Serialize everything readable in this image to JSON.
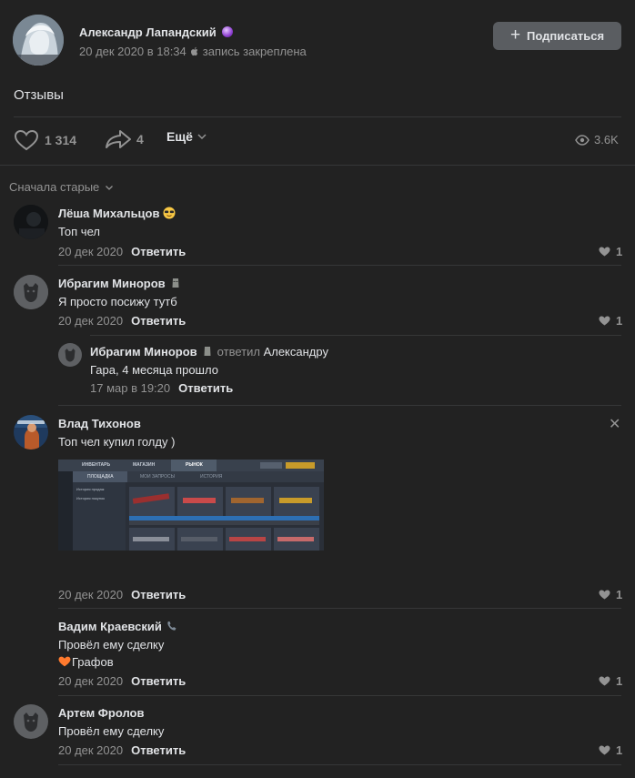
{
  "post": {
    "author": "Александр Лапандский",
    "meta_date": "20 дек 2020 в 18:34",
    "meta_pinned": "запись закреплена",
    "subscribe_label": "Подписаться",
    "text": "Отзывы",
    "likes": "1 314",
    "shares": "4",
    "more_label": "Ещё",
    "views": "3.6K"
  },
  "comments_sort": "Сначала старые",
  "reply_label": "Ответить",
  "comments": [
    {
      "name": "Лёша Михальцов",
      "text": "Топ чел",
      "date": "20 дек 2020",
      "likes": "1"
    },
    {
      "name": "Ибрагим Миноров",
      "text": "Я просто посижу тутб",
      "date": "20 дек 2020",
      "likes": "1"
    },
    {
      "name": "Ибрагим Миноров",
      "replied": "ответил",
      "reply_target": "Александру",
      "text": "Гара, 4 месяца прошло",
      "date": "17 мар в 19:20"
    },
    {
      "name": "Влад Тихонов",
      "text": "Топ чел купил голду )",
      "date": "20 дек 2020",
      "likes": "1"
    },
    {
      "name": "Вадим Краевский",
      "text": "Провёл ему сделку",
      "text2": "Графов",
      "date": "20 дек 2020",
      "likes": "1"
    },
    {
      "name": "Артем Фролов",
      "text": "Провёл ему сделку",
      "date": "20 дек 2020",
      "likes": "1"
    }
  ],
  "attachment": {
    "tabs": [
      "ИНВЕНТАРЬ",
      "МАГАЗИН",
      "РЫНОК"
    ],
    "subtabs": [
      "ПЛОЩАДКА",
      "МОИ ЗАПРОСЫ",
      "ИСТОРИЯ"
    ],
    "side_items": [
      "История продаж",
      "История покупок"
    ]
  },
  "colors": {
    "background": "#222222",
    "text": "#e1e3e6",
    "secondary": "#939393",
    "divider": "#363738",
    "button": "#5a5d61"
  },
  "icons": [
    "heart-icon",
    "share-icon",
    "chevron-down-icon",
    "eye-icon",
    "plus-icon",
    "close-icon",
    "apple-icon"
  ]
}
